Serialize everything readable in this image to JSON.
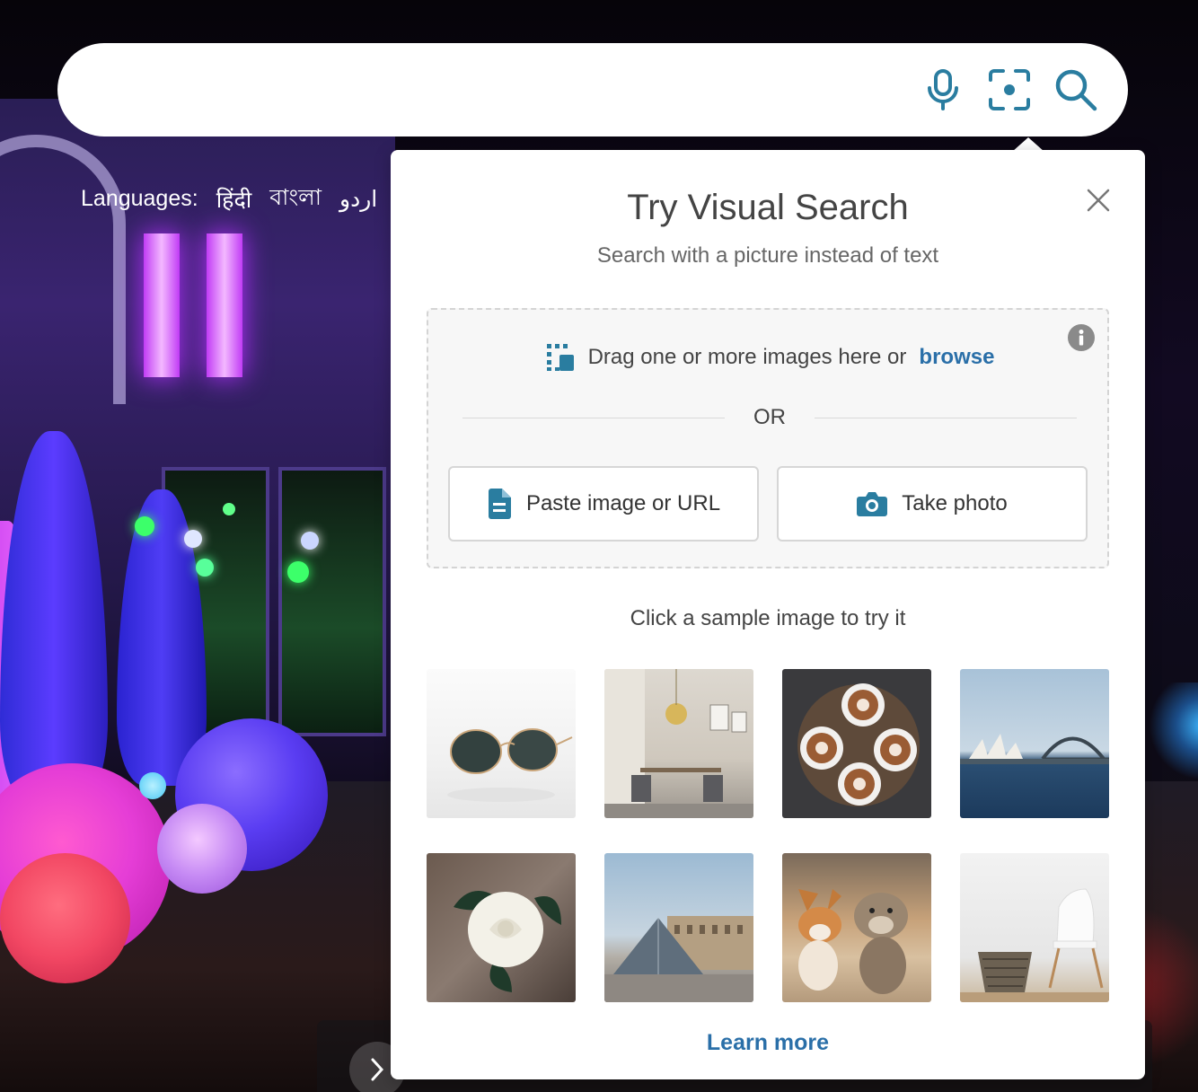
{
  "search": {
    "placeholder": "",
    "value": ""
  },
  "languages": {
    "label": "Languages:",
    "items": [
      "हिंदी",
      "বাংলা",
      "اردو"
    ]
  },
  "visual_search": {
    "title": "Try Visual Search",
    "subtitle": "Search with a picture instead of text",
    "drag_text": "Drag one or more images here or",
    "browse_label": "browse",
    "or_label": "OR",
    "paste_label": "Paste image or URL",
    "photo_label": "Take photo",
    "sample_caption": "Click a sample image to try it",
    "samples": [
      "sunglasses",
      "dining-room",
      "latte-art",
      "sydney-opera-house",
      "white-rose",
      "louvre-pyramid",
      "dogs",
      "chair-basket"
    ],
    "learn_more": "Learn more"
  },
  "colors": {
    "accent": "#2a6fa8",
    "icon": "#2a7da0"
  },
  "icons": [
    "microphone-icon",
    "visual-search-icon",
    "search-icon",
    "close-icon",
    "info-icon",
    "drop-image-icon",
    "document-icon",
    "camera-icon",
    "chevron-right-icon"
  ]
}
